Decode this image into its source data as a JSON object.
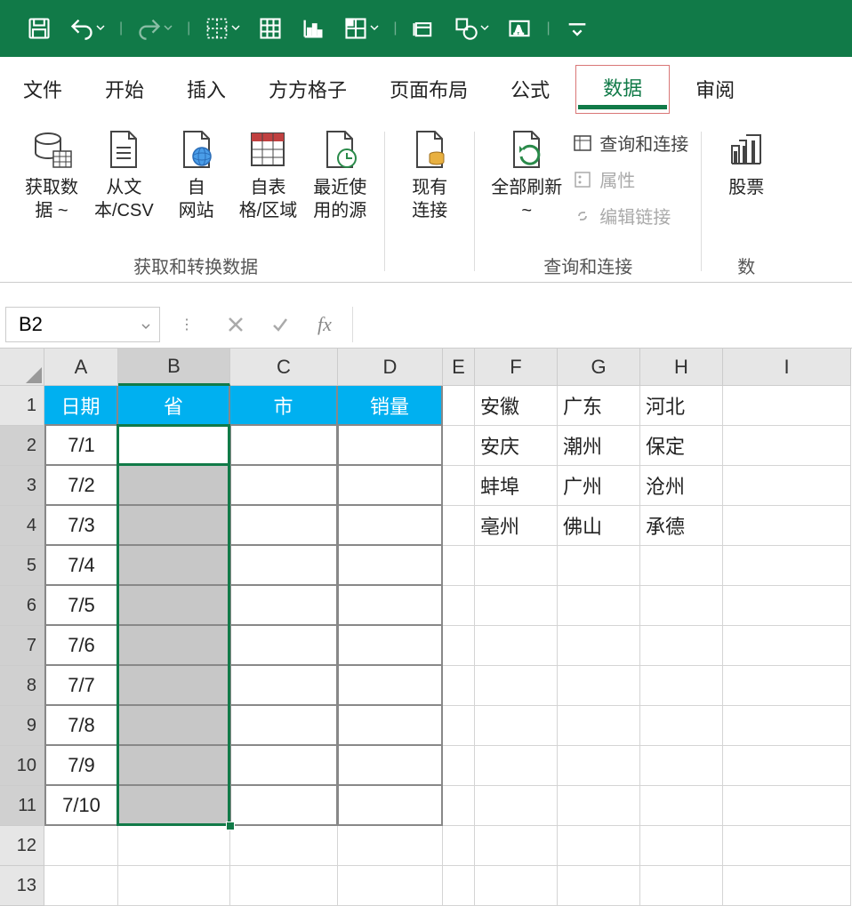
{
  "qat": {
    "save": "save",
    "undo": "undo",
    "redo": "redo",
    "border": "border",
    "table": "table",
    "chart": "chart",
    "pivotchart": "pivotchart",
    "group": "group",
    "shape": "shape",
    "textbox": "textbox",
    "more": "more"
  },
  "tabs": {
    "file": "文件",
    "home": "开始",
    "insert": "插入",
    "fangfang": "方方格子",
    "pagelayout": "页面布局",
    "formula": "公式",
    "data": "数据",
    "review": "审阅"
  },
  "ribbon": {
    "getdata": {
      "label": "获取数\n据 ~"
    },
    "fromcsv": {
      "label": "从文\n本/CSV"
    },
    "fromweb": {
      "label": "自\n网站"
    },
    "fromtable": {
      "label": "自表\n格/区域"
    },
    "recent": {
      "label": "最近使\n用的源"
    },
    "existing": {
      "label": "现有\n连接"
    },
    "refresh": {
      "label": "全部刷新\n~"
    },
    "queries": "查询和连接",
    "properties": "属性",
    "editlinks": "编辑链接",
    "stocks": "股票",
    "group1_label": "获取和转换数据",
    "group2_label": "查询和连接",
    "group3_label": "数"
  },
  "formula_bar": {
    "name_box": "B2",
    "fx": "fx"
  },
  "columns": [
    "A",
    "B",
    "C",
    "D",
    "E",
    "F",
    "G",
    "H",
    "I"
  ],
  "row_count": 13,
  "table_headers": [
    "日期",
    "省",
    "市",
    "销量"
  ],
  "dates": [
    "7/1",
    "7/2",
    "7/3",
    "7/4",
    "7/5",
    "7/6",
    "7/7",
    "7/8",
    "7/9",
    "7/10"
  ],
  "lookup": {
    "F": [
      "安徽",
      "安庆",
      "蚌埠",
      "亳州"
    ],
    "G": [
      "广东",
      "潮州",
      "广州",
      "佛山"
    ],
    "H": [
      "河北",
      "保定",
      "沧州",
      "承德"
    ]
  }
}
